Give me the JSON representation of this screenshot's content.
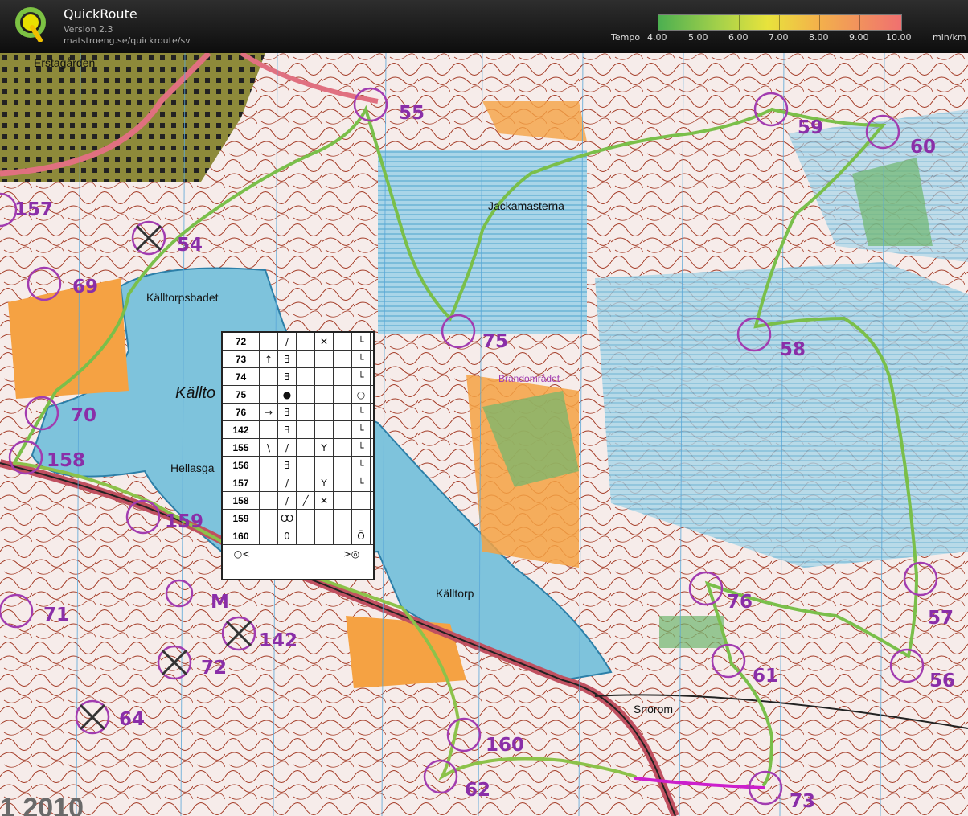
{
  "app": {
    "title": "QuickRoute",
    "version": "Version 2.3",
    "url": "matstroeng.se/quickroute/sv",
    "logo_icon": "quickroute-q-logo-icon"
  },
  "pace_legend": {
    "label": "Tempo",
    "values": [
      "4.00",
      "5.00",
      "6.00",
      "7.00",
      "8.00",
      "9.00",
      "10.00"
    ],
    "unit": "min/km",
    "colors": {
      "fast": "#4caf50",
      "medium": "#e8e33c",
      "slow": "#f07070"
    }
  },
  "map": {
    "colors": {
      "water": "#7ec3dc",
      "marsh": "#aed7e6",
      "open_land": "#f5a243",
      "forest_green": "#6fb66d",
      "urban": "#8e8a3a",
      "road": "#e07080",
      "course": "#a23cb0",
      "contour": "#8b2a1a",
      "route_slow": "#cc1fcc"
    },
    "place_names": [
      {
        "id": "erstagarden",
        "text": "Erstagården"
      },
      {
        "id": "kalltorpsbadet",
        "text": "Källtorpsbadet"
      },
      {
        "id": "kallto",
        "text": "Källto"
      },
      {
        "id": "hellasga",
        "text": "Hellasga"
      },
      {
        "id": "jackamasterna",
        "text": "Jackamasterna"
      },
      {
        "id": "brandomradet",
        "text": "Brandområdet"
      },
      {
        "id": "kalltorp",
        "text": "Källtorp"
      },
      {
        "id": "snorom",
        "text": "Snorom"
      },
      {
        "id": "m",
        "text": "M"
      }
    ],
    "controls": [
      {
        "number": "55"
      },
      {
        "number": "59"
      },
      {
        "number": "60"
      },
      {
        "number": "157"
      },
      {
        "number": "54"
      },
      {
        "number": "69"
      },
      {
        "number": "75"
      },
      {
        "number": "58"
      },
      {
        "number": "70"
      },
      {
        "number": "158"
      },
      {
        "number": "159"
      },
      {
        "number": "71"
      },
      {
        "number": "142"
      },
      {
        "number": "72"
      },
      {
        "number": "64"
      },
      {
        "number": "76"
      },
      {
        "number": "57"
      },
      {
        "number": "61"
      },
      {
        "number": "56"
      },
      {
        "number": "160"
      },
      {
        "number": "62"
      },
      {
        "number": "73"
      }
    ],
    "year_fragment": "1 2010",
    "description_sheet": {
      "rows": [
        {
          "code": "72",
          "c1": "",
          "c2": "/",
          "c3": "",
          "c4": "✕",
          "c5": "",
          "c6": "└"
        },
        {
          "code": "73",
          "c1": "↑",
          "c2": "Ǝ",
          "c3": "",
          "c4": "",
          "c5": "",
          "c6": "└"
        },
        {
          "code": "74",
          "c1": "",
          "c2": "Ǝ",
          "c3": "",
          "c4": "",
          "c5": "",
          "c6": "└"
        },
        {
          "code": "75",
          "c1": "",
          "c2": "●",
          "c3": "",
          "c4": "",
          "c5": "",
          "c6": "○"
        },
        {
          "code": "76",
          "c1": "→",
          "c2": "Ǝ",
          "c3": "",
          "c4": "",
          "c5": "",
          "c6": "└"
        },
        {
          "code": "142",
          "c1": "",
          "c2": "Ǝ",
          "c3": "",
          "c4": "",
          "c5": "",
          "c6": "└"
        },
        {
          "code": "155",
          "c1": "\\",
          "c2": "/",
          "c3": "",
          "c4": "Y",
          "c5": "",
          "c6": "└"
        },
        {
          "code": "156",
          "c1": "",
          "c2": "Ǝ",
          "c3": "",
          "c4": "",
          "c5": "",
          "c6": "└"
        },
        {
          "code": "157",
          "c1": "",
          "c2": "/",
          "c3": "",
          "c4": "Y",
          "c5": "",
          "c6": "└"
        },
        {
          "code": "158",
          "c1": "",
          "c2": "/",
          "c3": "╱",
          "c4": "✕",
          "c5": "",
          "c6": ""
        },
        {
          "code": "159",
          "c1": "",
          "c2": "Ꝏ",
          "c3": "",
          "c4": "",
          "c5": "",
          "c6": ""
        },
        {
          "code": "160",
          "c1": "",
          "c2": "0",
          "c3": "",
          "c4": "",
          "c5": "",
          "c6": "Ō"
        }
      ],
      "footer_left": "○<",
      "footer_right": ">◎"
    }
  }
}
